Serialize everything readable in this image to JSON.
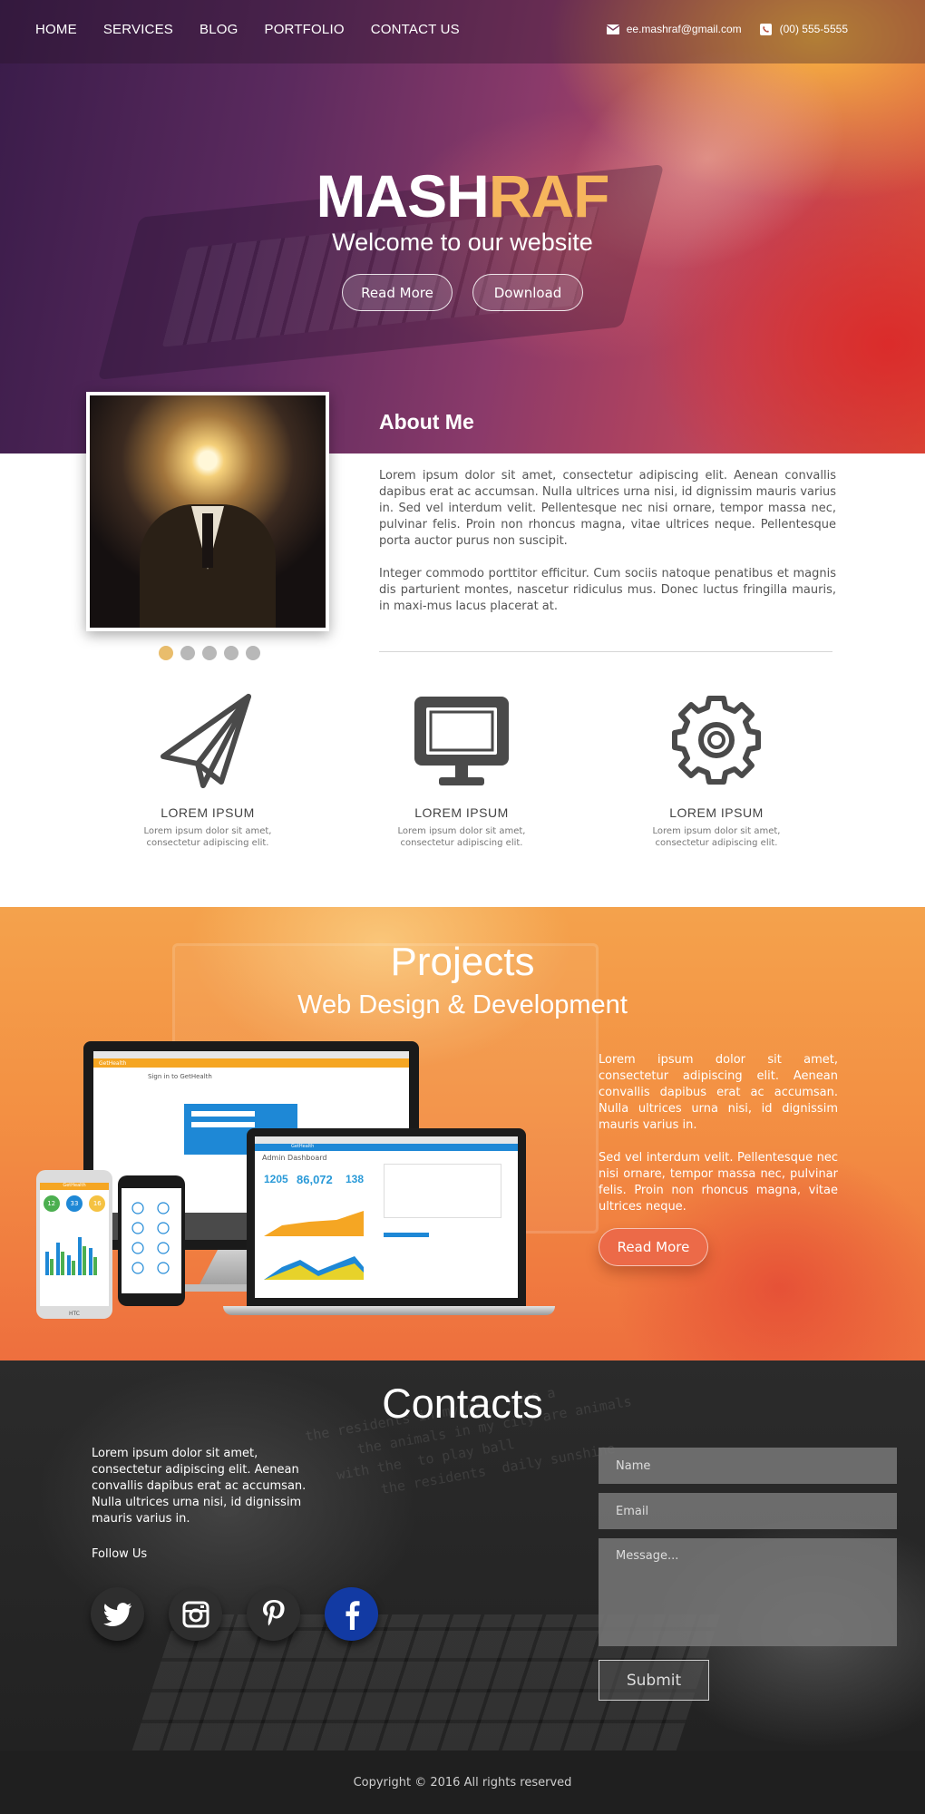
{
  "nav": {
    "links": [
      "HOME",
      "SERVICES",
      "BLOG",
      "PORTFOLIO",
      "CONTACT US"
    ],
    "email": "ee.mashraf@gmail.com",
    "phone": "(00) 555-5555"
  },
  "hero": {
    "title_part1": "MASH",
    "title_part2": "RAF",
    "subtitle": "Welcome to our website",
    "read_more": "Read More",
    "download": "Download"
  },
  "about": {
    "title": "About Me",
    "paragraph1": "Lorem ipsum dolor sit amet, consectetur adipiscing elit. Aenean convallis dapibus erat ac accumsan. Nulla ultrices urna nisi, id dignissim mauris varius in. Sed vel interdum velit. Pellentesque nec nisi ornare, tempor massa nec, pulvinar felis. Proin non rhoncus magna, vitae ultrices neque. Pellentesque porta auctor purus non suscipit.",
    "paragraph2": "Integer commodo porttitor efficitur. Cum sociis natoque penatibus et magnis dis parturient montes, nascetur ridiculus mus. Donec luctus fringilla mauris, in maxi-mus lacus placerat at.",
    "slider_dots": 5,
    "active_dot": 0
  },
  "features": [
    {
      "icon": "paper-plane-icon",
      "title": "LOREM IPSUM",
      "desc": "Lorem ipsum dolor sit amet, consectetur adipiscing elit."
    },
    {
      "icon": "monitor-icon",
      "title": "LOREM IPSUM",
      "desc": "Lorem ipsum dolor sit amet, consectetur adipiscing elit."
    },
    {
      "icon": "gear-icon",
      "title": "LOREM IPSUM",
      "desc": "Lorem ipsum dolor sit amet, consectetur adipiscing elit."
    }
  ],
  "projects": {
    "title": "Projects",
    "subtitle": "Web Design & Development",
    "paragraph1": "Lorem ipsum dolor sit amet, consectetur adipiscing elit. Aenean convallis dapibus erat ac accumsan. Nulla ultrices urna nisi, id dignissim mauris varius in.",
    "paragraph2": "Sed vel interdum velit. Pellentesque nec nisi ornare, tempor massa nec, pulvinar felis. Proin non rhoncus magna, vitae ultrices neque.",
    "read_more": "Read More",
    "mockup": {
      "brand": "GetHealth",
      "signin": "Sign in to GetHealth",
      "dashboard": "Admin Dashboard",
      "stat1": "1205",
      "stat2": "86,072",
      "stat3": "138",
      "phone_stats": [
        "12",
        "33",
        "16"
      ],
      "phone_brand": "HTC"
    }
  },
  "contacts": {
    "title": "Contacts",
    "text": "Lorem ipsum dolor sit amet, consectetur adipiscing elit. Aenean convallis dapibus erat ac accumsan. Nulla ultrices urna nisi, id dignissim mauris varius in.",
    "follow": "Follow Us",
    "socials": [
      "twitter-icon",
      "instagram-icon",
      "pinterest-icon",
      "facebook-icon"
    ],
    "name_placeholder": "Name",
    "email_placeholder": "Email",
    "message_placeholder": "Message...",
    "submit": "Submit"
  },
  "footer": {
    "copyright": "Copyright © 2016 All rights reserved"
  },
  "colors": {
    "accent": "#f6b55d",
    "orange_button": "#ec6a48",
    "facebook": "#123aa3",
    "dot_active": "#e9bd6c"
  }
}
